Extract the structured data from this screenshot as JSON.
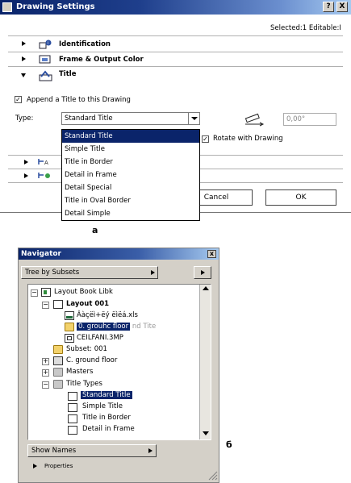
{
  "dialog": {
    "title": "Drawing Settings",
    "help_btn": "?",
    "close_btn": "X",
    "selected_info": "Selected:1 Editable:I",
    "sections": [
      {
        "label": "Identification"
      },
      {
        "label": "Frame & Output Color"
      },
      {
        "label": "Title"
      }
    ],
    "append_title_label": "Append a Title to this Drawing",
    "type_label": "Type:",
    "type_value": "Standard Title",
    "angle_value": "0,00°",
    "rotate_label": "Rotate with Drawing",
    "cancel_label": "Cancel",
    "ok_label": "OK",
    "dropdown_options": [
      "Standard Title",
      "Simple Title",
      "Title in Border",
      "Detail in Frame",
      "Detail Special",
      "Title in Oval Border",
      "Detail Simple"
    ],
    "caption": "a"
  },
  "navigator": {
    "title": "Navigator",
    "close_btn": "x",
    "view_mode": "Tree by Subsets",
    "show_names": "Show Names",
    "properties": "Properties",
    "tree": {
      "root": "Layout Book Libk",
      "layout": "Layout 001",
      "items": [
        "Âàçëì+ëý ëìëá.xls",
        "0. grouhc floor",
        "CEILFANI.3MP"
      ],
      "ghost_text": "nd Tite",
      "subset": "Subset: 001",
      "ground_floor": "C. ground floor",
      "masters": "Masters",
      "title_types": "Title Types",
      "title_type_items": [
        "Standard Title",
        "Simple Title",
        "Title in Border",
        "Detail in Frame"
      ]
    },
    "caption": "б"
  }
}
